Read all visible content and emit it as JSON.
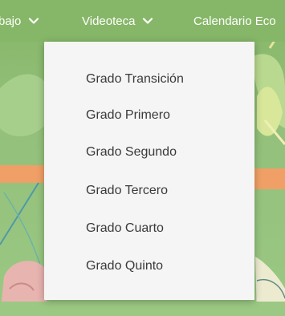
{
  "nav": {
    "items": [
      {
        "label": "bajo",
        "icon": "chevron-down-icon"
      },
      {
        "label": "Videoteca",
        "icon": "chevron-down-icon"
      },
      {
        "label": "Calendario Eco"
      }
    ]
  },
  "dropdown": {
    "items": [
      {
        "label": "Grado Transición"
      },
      {
        "label": "Grado Primero"
      },
      {
        "label": "Grado Segundo"
      },
      {
        "label": "Grado Tercero"
      },
      {
        "label": "Grado Cuarto"
      },
      {
        "label": "Grado Quinto"
      }
    ]
  },
  "colors": {
    "nav_bg": "#86b768",
    "nav_text": "#ffffff",
    "menu_bg": "#f5f5f5",
    "menu_text": "#3a3a3a"
  }
}
